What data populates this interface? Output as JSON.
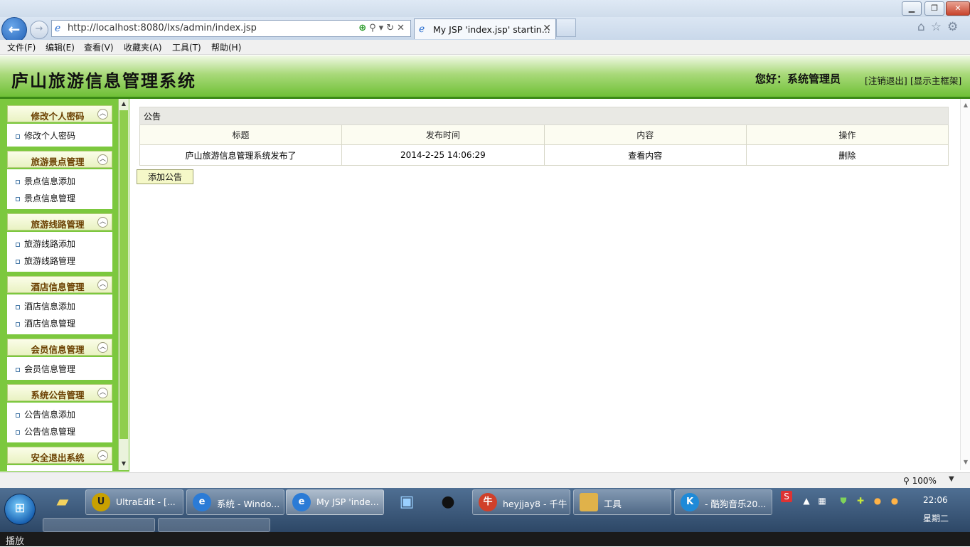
{
  "browser": {
    "url": "http://localhost:8080/lxs/admin/index.jsp",
    "tab_title": "My JSP 'index.jsp' startin...",
    "tab_close": "✕",
    "menu": [
      "文件(F)",
      "编辑(E)",
      "查看(V)",
      "收藏夹(A)",
      "工具(T)",
      "帮助(H)"
    ],
    "zoom": "100%"
  },
  "header": {
    "title": "庐山旅游信息管理系统",
    "greeting": "您好：系统管理员",
    "logout": "[注销退出]",
    "show_frame": "[显示主框架]"
  },
  "sidebar": {
    "groups": [
      {
        "title": "修改个人密码",
        "items": [
          "修改个人密码"
        ]
      },
      {
        "title": "旅游景点管理",
        "items": [
          "景点信息添加",
          "景点信息管理"
        ]
      },
      {
        "title": "旅游线路管理",
        "items": [
          "旅游线路添加",
          "旅游线路管理"
        ]
      },
      {
        "title": "酒店信息管理",
        "items": [
          "酒店信息添加",
          "酒店信息管理"
        ]
      },
      {
        "title": "会员信息管理",
        "items": [
          "会员信息管理"
        ]
      },
      {
        "title": "系统公告管理",
        "items": [
          "公告信息添加",
          "公告信息管理"
        ]
      },
      {
        "title": "安全退出系统",
        "items": []
      }
    ]
  },
  "notice": {
    "caption": "公告",
    "columns": [
      "标题",
      "发布时间",
      "内容",
      "操作"
    ],
    "rows": [
      {
        "title": "庐山旅游信息管理系统发布了",
        "time": "2014-2-25 14:06:29",
        "content": "查看内容",
        "action": "删除"
      }
    ],
    "add_button": "添加公告"
  },
  "taskbar": {
    "tasks": [
      {
        "label": "UltraEdit - [...",
        "icon": "ultraedit-icon"
      },
      {
        "label": "系统 - Windo...",
        "icon": "ie-icon"
      },
      {
        "label": "My JSP 'inde...",
        "icon": "ie-icon"
      },
      {
        "label": "heyjjay8 - 千牛",
        "icon": "qianniu-icon"
      },
      {
        "label": "工具",
        "icon": "folder-icon"
      },
      {
        "label": "- 酷狗音乐20...",
        "icon": "kugou-icon"
      }
    ],
    "time": "22:06",
    "day": "星期二"
  },
  "status": {
    "play": "播放"
  },
  "colors": {
    "header_green": "#6fc036",
    "sidebar_green": "#7cc83e",
    "taskbar": "#3d5a7c"
  }
}
